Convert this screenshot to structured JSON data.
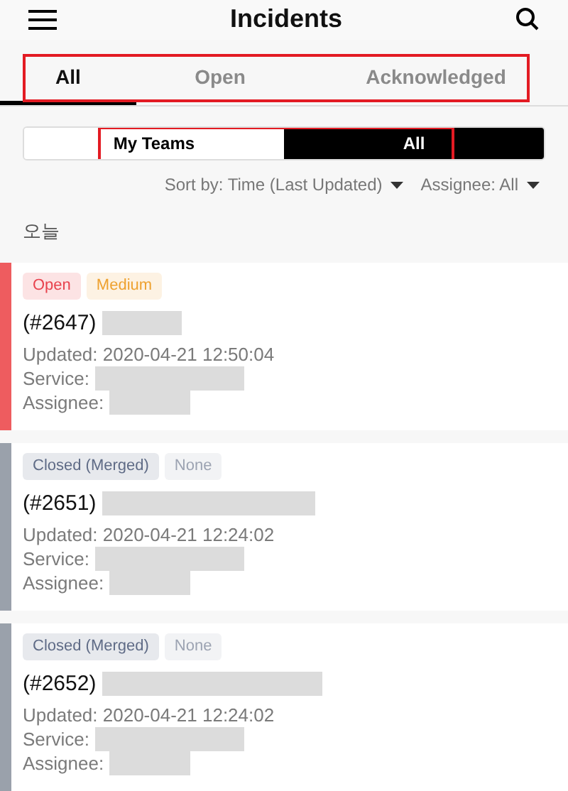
{
  "header": {
    "title": "Incidents"
  },
  "tabs": {
    "highlighted": true,
    "items": [
      {
        "label": "All",
        "selected": true
      },
      {
        "label": "Open",
        "selected": false
      },
      {
        "label": "Acknowledged",
        "selected": false
      }
    ]
  },
  "team_filter": {
    "highlighted": true,
    "options": [
      {
        "label": "My Teams",
        "selected": false
      },
      {
        "label": "All",
        "selected": true
      }
    ]
  },
  "sort": {
    "label": "Sort by: Time (Last Updated)"
  },
  "assignee_filter": {
    "label": "Assignee: All"
  },
  "section": {
    "title": "오늘"
  },
  "incidents": [
    {
      "color": "#ee5c5f",
      "status": {
        "label": "Open",
        "color": "#e8424d"
      },
      "urgency": {
        "label": "Medium",
        "color": "#eea12f"
      },
      "number": "(#2647)",
      "updated": "Updated: 2020-04-21 12:50:04",
      "service_label": "Service:",
      "assignee_label": "Assignee:"
    },
    {
      "color": "#9aa1ab",
      "status": {
        "label": "Closed (Merged)",
        "color": "#5f6b86"
      },
      "urgency": {
        "label": "None",
        "color": "#9ca3b2"
      },
      "number": "(#2651)",
      "updated": "Updated: 2020-04-21 12:24:02",
      "service_label": "Service:",
      "assignee_label": "Assignee:"
    },
    {
      "color": "#9aa1ab",
      "status": {
        "label": "Closed (Merged)",
        "color": "#5f6b86"
      },
      "urgency": {
        "label": "None",
        "color": "#9ca3b2"
      },
      "number": "(#2652)",
      "updated": "Updated: 2020-04-21 12:24:02",
      "service_label": "Service:",
      "assignee_label": "Assignee:"
    }
  ]
}
